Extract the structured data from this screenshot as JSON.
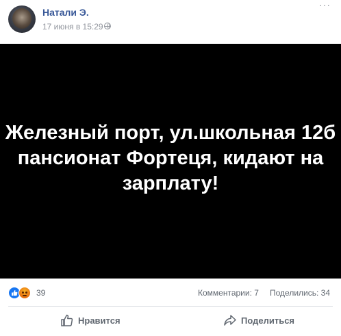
{
  "post": {
    "author": "Натали Э.",
    "timestamp": "17 июня в 15:29",
    "media_text": "Железный порт, ул.школьная 12б пансионат Фортеця, кидают на зарплату!"
  },
  "stats": {
    "reaction_count": "39",
    "comments": "Комментарии: 7",
    "shares": "Поделились: 34"
  },
  "actions": {
    "like_label": "Нравится",
    "share_label": "Поделиться"
  },
  "colors": {
    "author_link": "#385898",
    "secondary_text": "#90949c",
    "action_text": "#606770",
    "like_reaction": "#1877f2",
    "media_background": "#000000"
  },
  "icons": [
    "more-icon",
    "globe-icon",
    "like-reaction-icon",
    "angry-reaction-icon",
    "thumbs-up-icon",
    "share-arrow-icon"
  ]
}
